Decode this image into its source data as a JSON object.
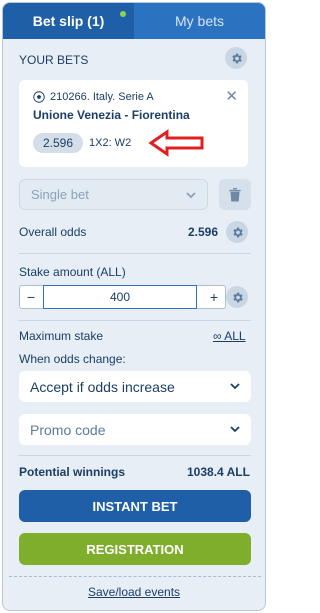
{
  "tabs": {
    "bet_slip": "Bet slip (1)",
    "my_bets": "My bets"
  },
  "your_bets_label": "YOUR BETS",
  "bet": {
    "league": "210266. Italy. Serie A",
    "match": "Unione Venezia - Fiorentina",
    "odds": "2.596",
    "outcome": "1X2: W2",
    "close_symbol": "✕"
  },
  "bet_type": {
    "selected": "Single bet"
  },
  "overall_odds": {
    "label": "Overall odds",
    "value": "2.596"
  },
  "stake": {
    "label": "Stake amount (ALL)",
    "value": "400",
    "minus": "−",
    "plus": "+"
  },
  "max_stake": {
    "label": "Maximum stake",
    "link": "∞ ALL"
  },
  "odds_change": {
    "label": "When odds change:",
    "selected": "Accept if odds increase"
  },
  "promo": {
    "placeholder": "Promo code"
  },
  "potential": {
    "label": "Potential winnings",
    "value": "1038.4 ALL"
  },
  "buttons": {
    "instant_bet": "INSTANT BET",
    "registration": "REGISTRATION"
  },
  "footer": {
    "save_load": "Save/load events"
  },
  "colors": {
    "primary": "#1f5fa8",
    "tab_inactive": "#2b73c1",
    "registration": "#7fae2c",
    "arrow": "#e02020",
    "panel_bg": "#e7eef5"
  },
  "icons": {
    "settings": "gear-icon",
    "delete": "trash-icon",
    "sport": "football-icon",
    "dropdown": "chevron-down-icon",
    "annotation": "red-arrow-icon"
  }
}
